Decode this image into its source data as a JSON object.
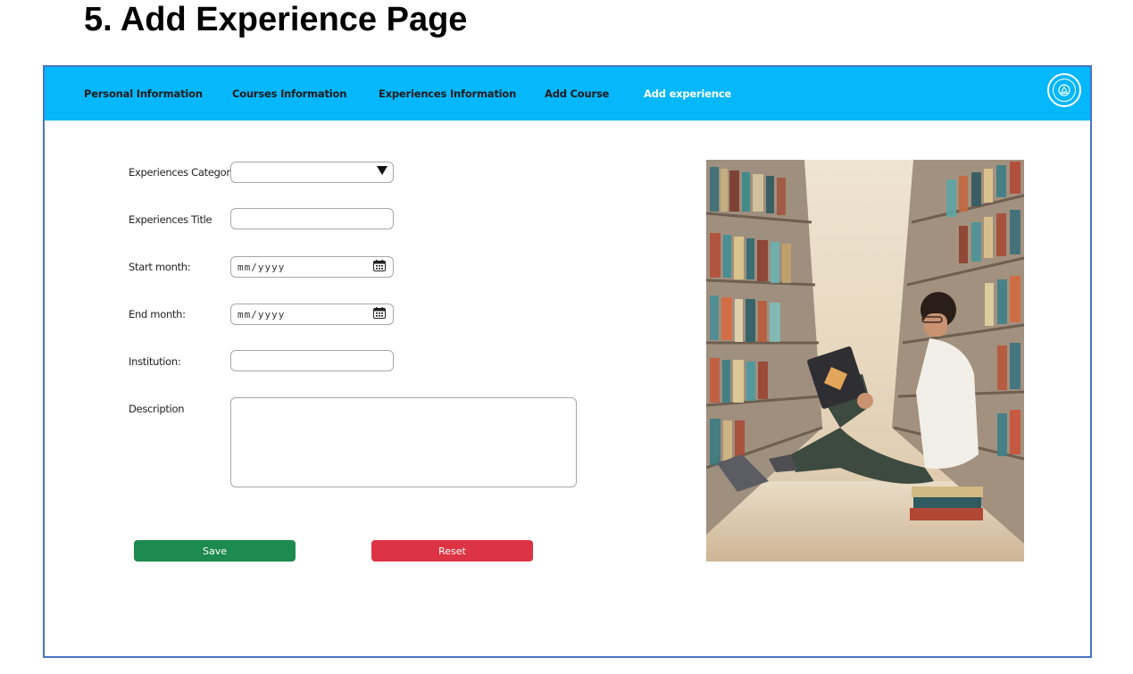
{
  "doc_heading": "5. Add Experience Page",
  "nav": {
    "items": [
      {
        "label": "Personal Information"
      },
      {
        "label": "Courses Information"
      },
      {
        "label": "Experiences Information"
      },
      {
        "label": "Add Course"
      },
      {
        "label": "Add experience",
        "active": true
      }
    ],
    "bar_color": "#05b7fb"
  },
  "form": {
    "category_label": "Experiences Category",
    "category_value": "",
    "title_label": "Experiences Title",
    "title_value": "",
    "start_label": "Start month:",
    "start_placeholder": "mm/yyyy",
    "end_label": "End month:",
    "end_placeholder": "mm/yyyy",
    "institution_label": "Institution:",
    "institution_value": "",
    "description_label": "Description",
    "description_value": ""
  },
  "buttons": {
    "save_label": "Save",
    "save_color": "#1d8a4f",
    "reset_label": "Reset",
    "reset_color": "#dc3445"
  },
  "icons": {
    "dropdown": "caret-down-icon",
    "calendar": "calendar-icon",
    "logo": "university-seal-logo"
  }
}
